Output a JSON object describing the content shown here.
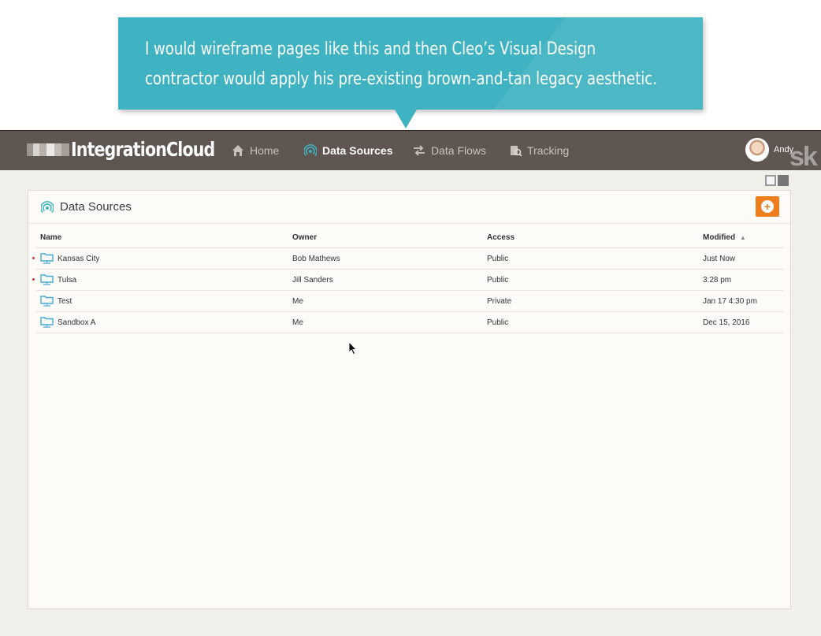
{
  "callout": {
    "line1": "I would wireframe pages like this and then Cleo’s Visual Design",
    "line2": "contractor would apply his pre-existing brown-and-tan legacy aesthetic."
  },
  "app": {
    "brand": "IntegrationCloud",
    "nav": [
      {
        "label": "Home",
        "icon": "home-icon",
        "active": false
      },
      {
        "label": "Data Sources",
        "icon": "data-sources-icon",
        "active": true
      },
      {
        "label": "Data Flows",
        "icon": "data-flows-icon",
        "active": false
      },
      {
        "label": "Tracking",
        "icon": "tracking-icon",
        "active": false
      }
    ],
    "user": {
      "name": "Andy"
    },
    "panel": {
      "title": "Data Sources",
      "columns": [
        "Name",
        "Owner",
        "Access",
        "Modified"
      ],
      "sort": {
        "column": "Modified",
        "direction": "ascending"
      },
      "rows": [
        {
          "name": "Kansas City",
          "owner": "Bob Mathews",
          "access": "Public",
          "modified": "Just Now",
          "flag": true
        },
        {
          "name": "Tulsa",
          "owner": "Jill Sanders",
          "access": "Public",
          "modified": "3:28 pm",
          "flag": true
        },
        {
          "name": "Test",
          "owner": "Me",
          "access": "Private",
          "modified": "Jan 17 4:30 pm",
          "flag": false
        },
        {
          "name": "Sandbox A",
          "owner": "Me",
          "access": "Public",
          "modified": "Dec 15, 2016",
          "flag": false
        }
      ]
    },
    "colors": {
      "navbar": "#5f5651",
      "accent": "#3fb3c2",
      "add_button": "#ee7d1c",
      "background": "#f1efea"
    }
  }
}
